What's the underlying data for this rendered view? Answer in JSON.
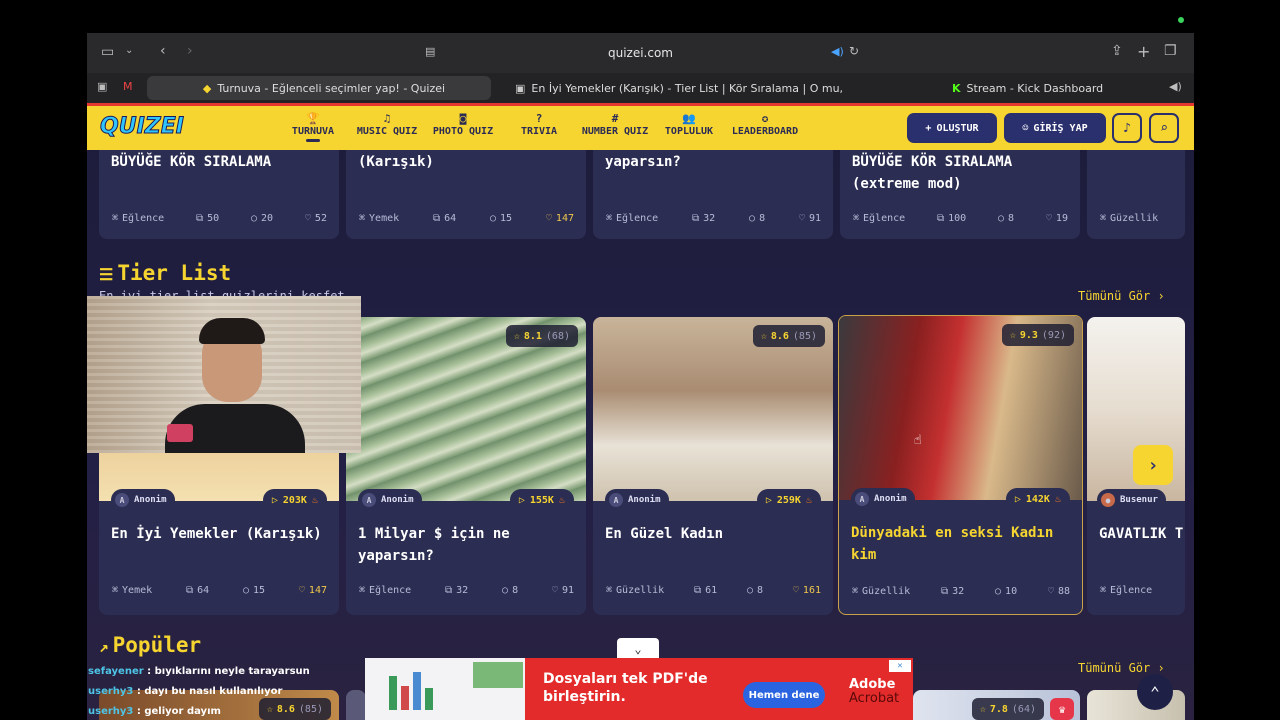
{
  "browser": {
    "url": "quizei.com",
    "tabs": [
      {
        "label": "Turnuva - Eğlenceli seçimler yap! - Quizei",
        "active": true
      },
      {
        "label": "En İyi Yemekler (Karışık) - Tier List | Kör Sıralama | O mu, Bu mu? |...",
        "active": false
      },
      {
        "label": "Stream - Kick Dashboard",
        "active": false
      }
    ]
  },
  "header": {
    "logo": "QUIZEI",
    "nav": [
      {
        "label": "TURNUVA",
        "icon": "trophy-icon",
        "glyph": "🏆",
        "active": true
      },
      {
        "label": "MUSIC QUIZ",
        "icon": "music-icon",
        "glyph": "♫",
        "active": false
      },
      {
        "label": "PHOTO QUIZ",
        "icon": "camera-icon",
        "glyph": "◙",
        "active": false
      },
      {
        "label": "TRIVIA",
        "icon": "question-icon",
        "glyph": "?",
        "active": false
      },
      {
        "label": "NUMBER QUIZ",
        "icon": "hash-icon",
        "glyph": "#",
        "active": false
      },
      {
        "label": "TOPLULUK",
        "icon": "users-icon",
        "glyph": "👥",
        "active": false
      },
      {
        "label": "LEADERBOARD",
        "icon": "medal-icon",
        "glyph": "✪",
        "active": false
      }
    ],
    "create_label": "OLUŞTUR",
    "login_label": "GİRİŞ YAP"
  },
  "top_row": [
    {
      "title": "BÜYÜĞE KÖR SIRALAMA",
      "category": "Eğlence",
      "items": "50",
      "comments": "20",
      "likes": "52",
      "hot": false
    },
    {
      "title": "(Karışık)",
      "category": "Yemek",
      "items": "64",
      "comments": "15",
      "likes": "147",
      "hot": true
    },
    {
      "title": "yaparsın?",
      "category": "Eğlence",
      "items": "32",
      "comments": "8",
      "likes": "91",
      "hot": false
    },
    {
      "title": "BÜYÜĞE KÖR SIRALAMA (extreme mod)",
      "category": "Eğlence",
      "items": "100",
      "comments": "8",
      "likes": "19",
      "hot": false
    },
    {
      "title": "",
      "category": "Güzellik",
      "items": "",
      "comments": "",
      "likes": "",
      "hot": false
    }
  ],
  "tier_section": {
    "title": "Tier List",
    "subtitle": "En iyi tier list quizlerini keşfet",
    "see_all": "Tümünü Gör",
    "cards": [
      {
        "title": "En İyi Yemekler (Karışık)",
        "author": "Anonim",
        "plays": "203K",
        "rating": "",
        "rating_count": "",
        "category": "Yemek",
        "items": "64",
        "comments": "15",
        "likes": "147",
        "hot": true
      },
      {
        "title": "1 Milyar $ için ne yaparsın?",
        "author": "Anonim",
        "plays": "155K",
        "rating": "8.1",
        "rating_count": "(68)",
        "category": "Eğlence",
        "items": "32",
        "comments": "8",
        "likes": "91",
        "hot": false
      },
      {
        "title": "En Güzel Kadın",
        "author": "Anonim",
        "plays": "259K",
        "rating": "8.6",
        "rating_count": "(85)",
        "category": "Güzellik",
        "items": "61",
        "comments": "8",
        "likes": "161",
        "hot": true
      },
      {
        "title": "Dünyadaki en seksi Kadın kim",
        "author": "Anonim",
        "plays": "142K",
        "rating": "9.3",
        "rating_count": "(92)",
        "category": "Güzellik",
        "items": "32",
        "comments": "10",
        "likes": "88",
        "hot": false
      },
      {
        "title": "GAVATLIK T",
        "author": "Busenur",
        "plays": "",
        "rating": "",
        "rating_count": "",
        "category": "Eğlence",
        "items": "",
        "comments": "",
        "likes": "",
        "hot": false
      }
    ]
  },
  "popular_section": {
    "title": "Popüler",
    "see_all": "Tümünü Gör",
    "ratings": [
      {
        "rating": "8.6",
        "count": "(85)"
      },
      {
        "rating": "7.8",
        "count": "(64)"
      }
    ]
  },
  "chat": [
    {
      "user": "sefayener",
      "message": "bıyıklarını neyle tarayarsun"
    },
    {
      "user": "userhy3",
      "message": "dayı bu nasıl kullanılıyor"
    },
    {
      "user": "userhy3",
      "message": "geliyor dayım"
    }
  ],
  "ad": {
    "headline": "Dosyaları tek PDF'de birleştirin.",
    "cta": "Hemen dene",
    "brand": "Adobe",
    "product": "Acrobat"
  },
  "colors": {
    "accent": "#f7d530",
    "header_bg": "#f7d530",
    "card_bg": "#2b2d52",
    "page_bg": "#1d1c3a"
  }
}
